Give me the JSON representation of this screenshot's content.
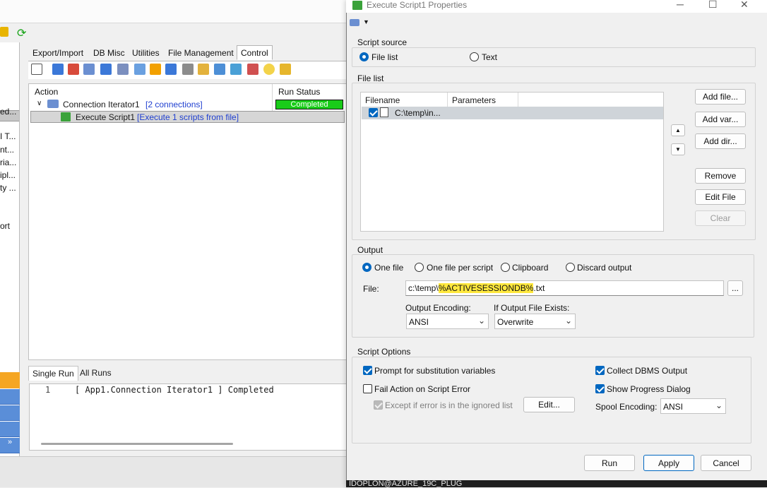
{
  "bg": {
    "left_truncated": [
      "ed...",
      "I T...",
      "nt...",
      "ria...",
      "ipl...",
      "ty ...",
      "ort"
    ],
    "tabs": [
      "Export/Import",
      "DB Misc",
      "Utilities",
      "File Management",
      "Control"
    ],
    "tree": {
      "col_action": "Action",
      "col_status": "Run Status",
      "iterator_label": "Connection Iterator1",
      "iterator_info": "[2 connections]",
      "iterator_status": "Completed",
      "script_label": "Execute Script1",
      "script_info": "[Execute 1 scripts from file]"
    },
    "bottom_tabs": [
      "Single Run",
      "All Runs"
    ],
    "console": {
      "line_no": "1",
      "text": "[ App1.Connection Iterator1 ] Completed"
    }
  },
  "dialog": {
    "title": "Execute Script1 Properties",
    "script_source": {
      "label": "Script source",
      "options": [
        "File list",
        "Text"
      ],
      "selected": "File list"
    },
    "file_list": {
      "label": "File list",
      "columns": [
        "Filename",
        "Parameters"
      ],
      "rows": [
        {
          "filename": "C:\\temp\\in...",
          "parameters": "",
          "checked": true
        }
      ],
      "buttons": {
        "add_file": "Add file...",
        "add_var": "Add var...",
        "add_dir": "Add dir...",
        "remove": "Remove",
        "edit_file": "Edit File",
        "clear": "Clear"
      }
    },
    "output": {
      "label": "Output",
      "options": [
        "One file",
        "One file per script",
        "Clipboard",
        "Discard output"
      ],
      "selected": "One file",
      "file_label": "File:",
      "file_prefix": "c:\\temp\\",
      "file_variable": "%ACTIVESESSIONDB%",
      "file_suffix": ".txt",
      "browse": "...",
      "encoding_label": "Output Encoding:",
      "encoding_value": "ANSI",
      "exists_label": "If Output File Exists:",
      "exists_value": "Overwrite"
    },
    "script_options": {
      "label": "Script Options",
      "prompt_sub": "Prompt for substitution variables",
      "fail_action": "Fail Action on Script Error",
      "except_ignored": "Except if error is in the ignored list",
      "edit": "Edit...",
      "collect_dbms": "Collect DBMS Output",
      "show_progress": "Show Progress Dialog",
      "spool_label": "Spool Encoding:",
      "spool_value": "ANSI"
    },
    "footer": {
      "run": "Run",
      "apply": "Apply",
      "cancel": "Cancel"
    },
    "status_text": "IDOPLON@AZURE_19C_PLUG"
  },
  "colors": {
    "accent": "#0067c0",
    "completed": "#19cc19",
    "highlight": "#ffe83d"
  }
}
